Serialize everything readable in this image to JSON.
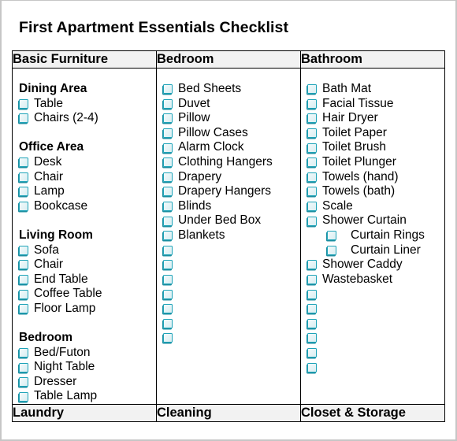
{
  "title": "First Apartment Essentials Checklist",
  "columns": [
    {
      "header": "Basic Furniture",
      "groups": [
        {
          "title": "Dining Area",
          "items": [
            "Table",
            "Chairs (2-4)"
          ]
        },
        {
          "title": "Office Area",
          "items": [
            "Desk",
            "Chair",
            "Lamp",
            "Bookcase"
          ]
        },
        {
          "title": "Living Room",
          "items": [
            "Sofa",
            "Chair",
            "End Table",
            "Coffee Table",
            "Floor Lamp"
          ]
        },
        {
          "title": "Bedroom",
          "items": [
            "Bed/Futon",
            "Night Table",
            "Dresser",
            "Table Lamp"
          ]
        }
      ]
    },
    {
      "header": "Bedroom",
      "items": [
        {
          "label": "Bed Sheets"
        },
        {
          "label": "Duvet"
        },
        {
          "label": "Pillow"
        },
        {
          "label": "Pillow Cases"
        },
        {
          "label": "Alarm Clock"
        },
        {
          "label": "Clothing Hangers"
        },
        {
          "label": "Drapery"
        },
        {
          "label": "Drapery Hangers"
        },
        {
          "label": "Blinds"
        },
        {
          "label": "Under Bed Box"
        },
        {
          "label": "Blankets"
        },
        {
          "label": ""
        },
        {
          "label": ""
        },
        {
          "label": ""
        },
        {
          "label": ""
        },
        {
          "label": ""
        },
        {
          "label": ""
        },
        {
          "label": ""
        }
      ]
    },
    {
      "header": "Bathroom",
      "items": [
        {
          "label": "Bath Mat"
        },
        {
          "label": "Facial Tissue"
        },
        {
          "label": "Hair Dryer"
        },
        {
          "label": "Toilet Paper"
        },
        {
          "label": "Toilet Brush"
        },
        {
          "label": "Toilet Plunger"
        },
        {
          "label": "Towels (hand)"
        },
        {
          "label": "Towels (bath)"
        },
        {
          "label": "Scale"
        },
        {
          "label": "Shower Curtain"
        },
        {
          "label": "Curtain Rings",
          "sub": true
        },
        {
          "label": "Curtain Liner",
          "sub": true
        },
        {
          "label": "Shower Caddy"
        },
        {
          "label": "Wastebasket"
        },
        {
          "label": ""
        },
        {
          "label": ""
        },
        {
          "label": ""
        },
        {
          "label": ""
        },
        {
          "label": ""
        },
        {
          "label": ""
        }
      ]
    }
  ],
  "footer_headers": [
    "Laundry",
    "Cleaning",
    "Closet & Storage"
  ],
  "colors": {
    "checkbox": "#1ea3b8",
    "header_bg": "#f2f2f2",
    "border": "#000000"
  }
}
